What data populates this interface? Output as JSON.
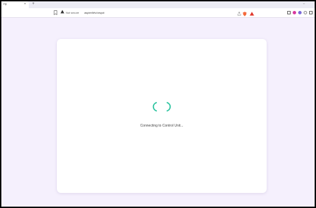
{
  "browser": {
    "tab_title": "Hy",
    "tab_close": "×",
    "new_tab": "+",
    "window_control": "–",
    "security_label": "Not secure",
    "url": "aspire/bfv/orsyot",
    "icons": {
      "back": "arrow-left-icon",
      "bookmark": "bookmark-icon",
      "warning": "warning-icon",
      "share": "share-icon",
      "brave_shield": "shield-icon",
      "rewards": "triangle-icon"
    }
  },
  "page": {
    "loading_text": "Connecting to Control Unit...",
    "spinner_color": "#2ec4a0",
    "background": "#f5f0fd"
  }
}
